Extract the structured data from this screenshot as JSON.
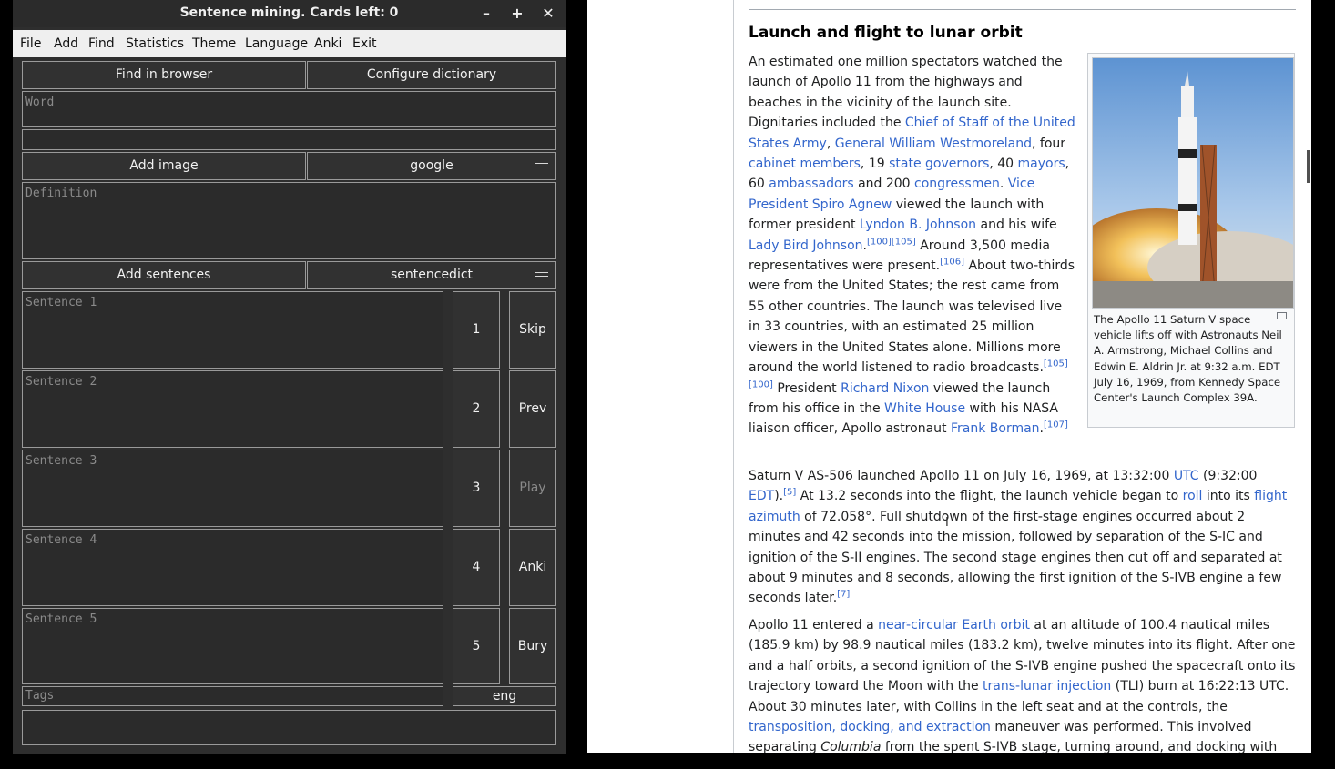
{
  "app": {
    "title": "Sentence mining. Cards left: 0",
    "window_buttons": [
      "–",
      "+",
      "✕"
    ],
    "menu": [
      "File",
      "Add",
      "Find",
      "Statistics",
      "Theme",
      "Language",
      "Anki",
      "Exit"
    ],
    "find_in_browser": "Find in browser",
    "configure_dictionary": "Configure dictionary",
    "word_placeholder": "Word",
    "add_image": "Add image",
    "image_source": "google",
    "definition_placeholder": "Definition",
    "add_sentences": "Add sentences",
    "sentence_source": "sentencedict",
    "sentences": [
      {
        "placeholder": "Sentence 1",
        "num": "1",
        "action": "Skip"
      },
      {
        "placeholder": "Sentence 2",
        "num": "2",
        "action": "Prev"
      },
      {
        "placeholder": "Sentence 3",
        "num": "3",
        "action": "Play"
      },
      {
        "placeholder": "Sentence 4",
        "num": "4",
        "action": "Anki"
      },
      {
        "placeholder": "Sentence 5",
        "num": "5",
        "action": "Bury"
      }
    ],
    "tags_placeholder": "Tags",
    "language": "eng"
  },
  "article": {
    "heading": "Launch and flight to lunar orbit",
    "p1": {
      "t1": "An estimated one million spectators watched the launch of Apollo 11 from the highways and beaches in the vicinity of the launch site. Dignitaries included the ",
      "l1": "Chief of Staff of the United States Army",
      "t2": ", ",
      "l2": "General William Westmoreland",
      "t3": ", four ",
      "l3": "cabinet members",
      "t4": ", 19 ",
      "l4": "state governors",
      "t5": ", 40 ",
      "l5": "mayors",
      "t6": ", 60 ",
      "l6": "ambassadors",
      "t7": " and 200 ",
      "l7": "congressmen",
      "t8": ". ",
      "l8": "Vice President Spiro Agnew",
      "t9": " viewed the launch with former president ",
      "l9": "Lyndon B. Johnson",
      "t10": " and his wife ",
      "l10": "Lady Bird Johnson",
      "t11": ".",
      "r1": "[100][105]",
      "t12": " Around 3,500 media representatives were present.",
      "r2": "[106]",
      "t13": " About two-thirds were from the United States; the rest came from 55 other countries. The launch was televised live in 33 countries, with an estimated 25 million viewers in the United States alone. Millions more around the world listened to radio broadcasts.",
      "r3": "[105][100]",
      "t14": " President ",
      "l11": "Richard Nixon",
      "t15": " viewed the launch from his office in the ",
      "l12": "White House",
      "t16": " with his NASA liaison officer, Apollo astronaut ",
      "l13": "Frank Borman",
      "t17": ".",
      "r4": "[107]"
    },
    "p2": {
      "t1": "Saturn V AS-506 launched Apollo 11 on July 16, 1969, at 13:32:00 ",
      "l1": "UTC",
      "t2": " (9:32:00 ",
      "l2": "EDT",
      "t3": ").",
      "r1": "[5]",
      "t4": " At 13.2 seconds into the flight, the launch vehicle began to ",
      "l3": "roll",
      "t5": " into its ",
      "l4": "flight azimuth",
      "t6": " of 72.058°. Full shutdown of the first-stage engines occurred about 2 minutes and 42 seconds into the mission, followed by separation of the S-IC and ignition of the S-II engines. The second stage engines then cut off and separated at about 9 minutes and 8 seconds, allowing the first ignition of the S-IVB engine a few seconds later.",
      "r2": "[7]"
    },
    "p3": {
      "t1": "Apollo 11 entered a ",
      "l1": "near-circular Earth orbit",
      "t2": " at an altitude of 100.4 nautical miles (185.9 km) by 98.9 nautical miles (183.2 km), twelve minutes into its flight. After one and a half orbits, a second ignition of the S-IVB engine pushed the spacecraft onto its trajectory toward the Moon with the ",
      "l2": "trans-lunar injection",
      "t3": " (TLI) burn at 16:22:13 UTC. About 30 minutes later, with Collins in the left seat and at the controls, the ",
      "l3": "transposition, docking, and extraction",
      "t4": " maneuver was performed. This involved separating ",
      "i1": "Columbia",
      "t5": " from the spent S-IVB stage, turning around, and docking with"
    },
    "caption": "The Apollo 11 Saturn V space vehicle lifts off with Astronauts Neil A. Armstrong, Michael Collins and Edwin E. Aldrin Jr. at 9:32 a.m. EDT July 16, 1969, from Kennedy Space Center's Launch Complex 39A."
  }
}
